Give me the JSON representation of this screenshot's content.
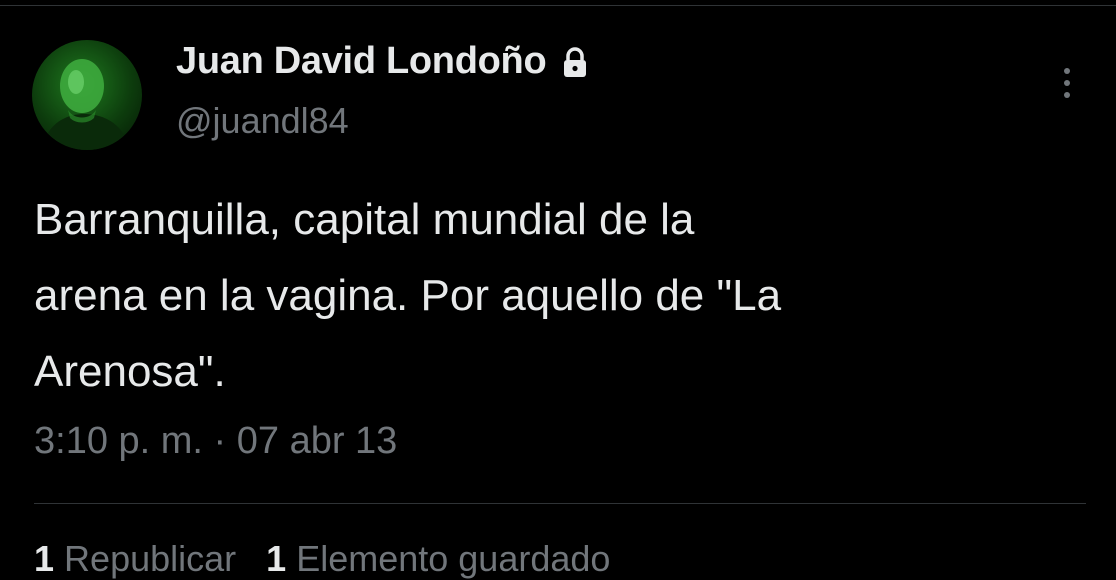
{
  "tweet": {
    "author": {
      "display_name": "Juan David Londoño",
      "handle": "@juandl84",
      "protected_icon": "lock-icon",
      "avatar_tint": "#1f7a1f"
    },
    "text": "Barranquilla, capital mundial de la\narena en la vagina. Por aquello de \"La\nArenosa\".",
    "timestamp": "3:10 p. m. · 07 abr 13",
    "stats": {
      "reposts_count": "1",
      "reposts_label": "Republicar",
      "bookmarks_count": "1",
      "bookmarks_label": "Elemento guardado"
    }
  },
  "menu_icon": "more-vertical-icon",
  "colors": {
    "background": "#000000",
    "primary_text": "#e7e9ea",
    "secondary_text": "#71767b",
    "divider": "#2f3336"
  }
}
